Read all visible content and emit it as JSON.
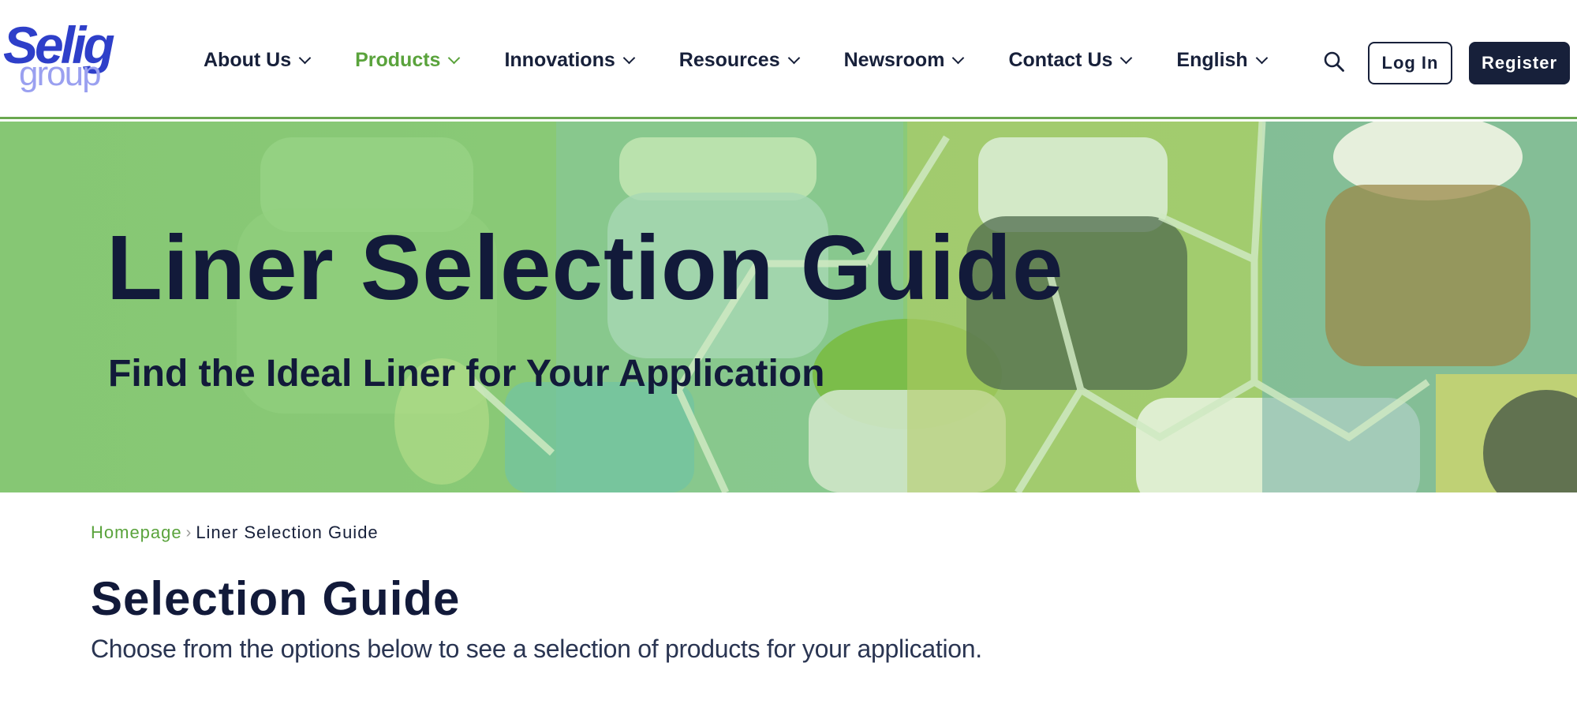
{
  "logo": {
    "line1": "Selig",
    "line2": "group"
  },
  "nav": {
    "items": [
      {
        "label": "About Us"
      },
      {
        "label": "Products"
      },
      {
        "label": "Innovations"
      },
      {
        "label": "Resources"
      },
      {
        "label": "Newsroom"
      },
      {
        "label": "Contact Us"
      },
      {
        "label": "English"
      }
    ],
    "active": "Products"
  },
  "header": {
    "search_icon": "search-icon",
    "login_label": "Log In",
    "register_label": "Register"
  },
  "hero": {
    "title": "Liner Selection Guide",
    "subtitle": "Find the Ideal Liner for Your Application",
    "overlay_color": "#7fc86a"
  },
  "breadcrumb": {
    "home": "Homepage",
    "separator": "›",
    "current": "Liner Selection Guide"
  },
  "main": {
    "title": "Selection Guide",
    "description": "Choose from the options below to see a selection of products for your application."
  },
  "colors": {
    "brand_navy": "#17203a",
    "accent_green": "#5aa33c",
    "logo_blue": "#2e3fc9"
  }
}
